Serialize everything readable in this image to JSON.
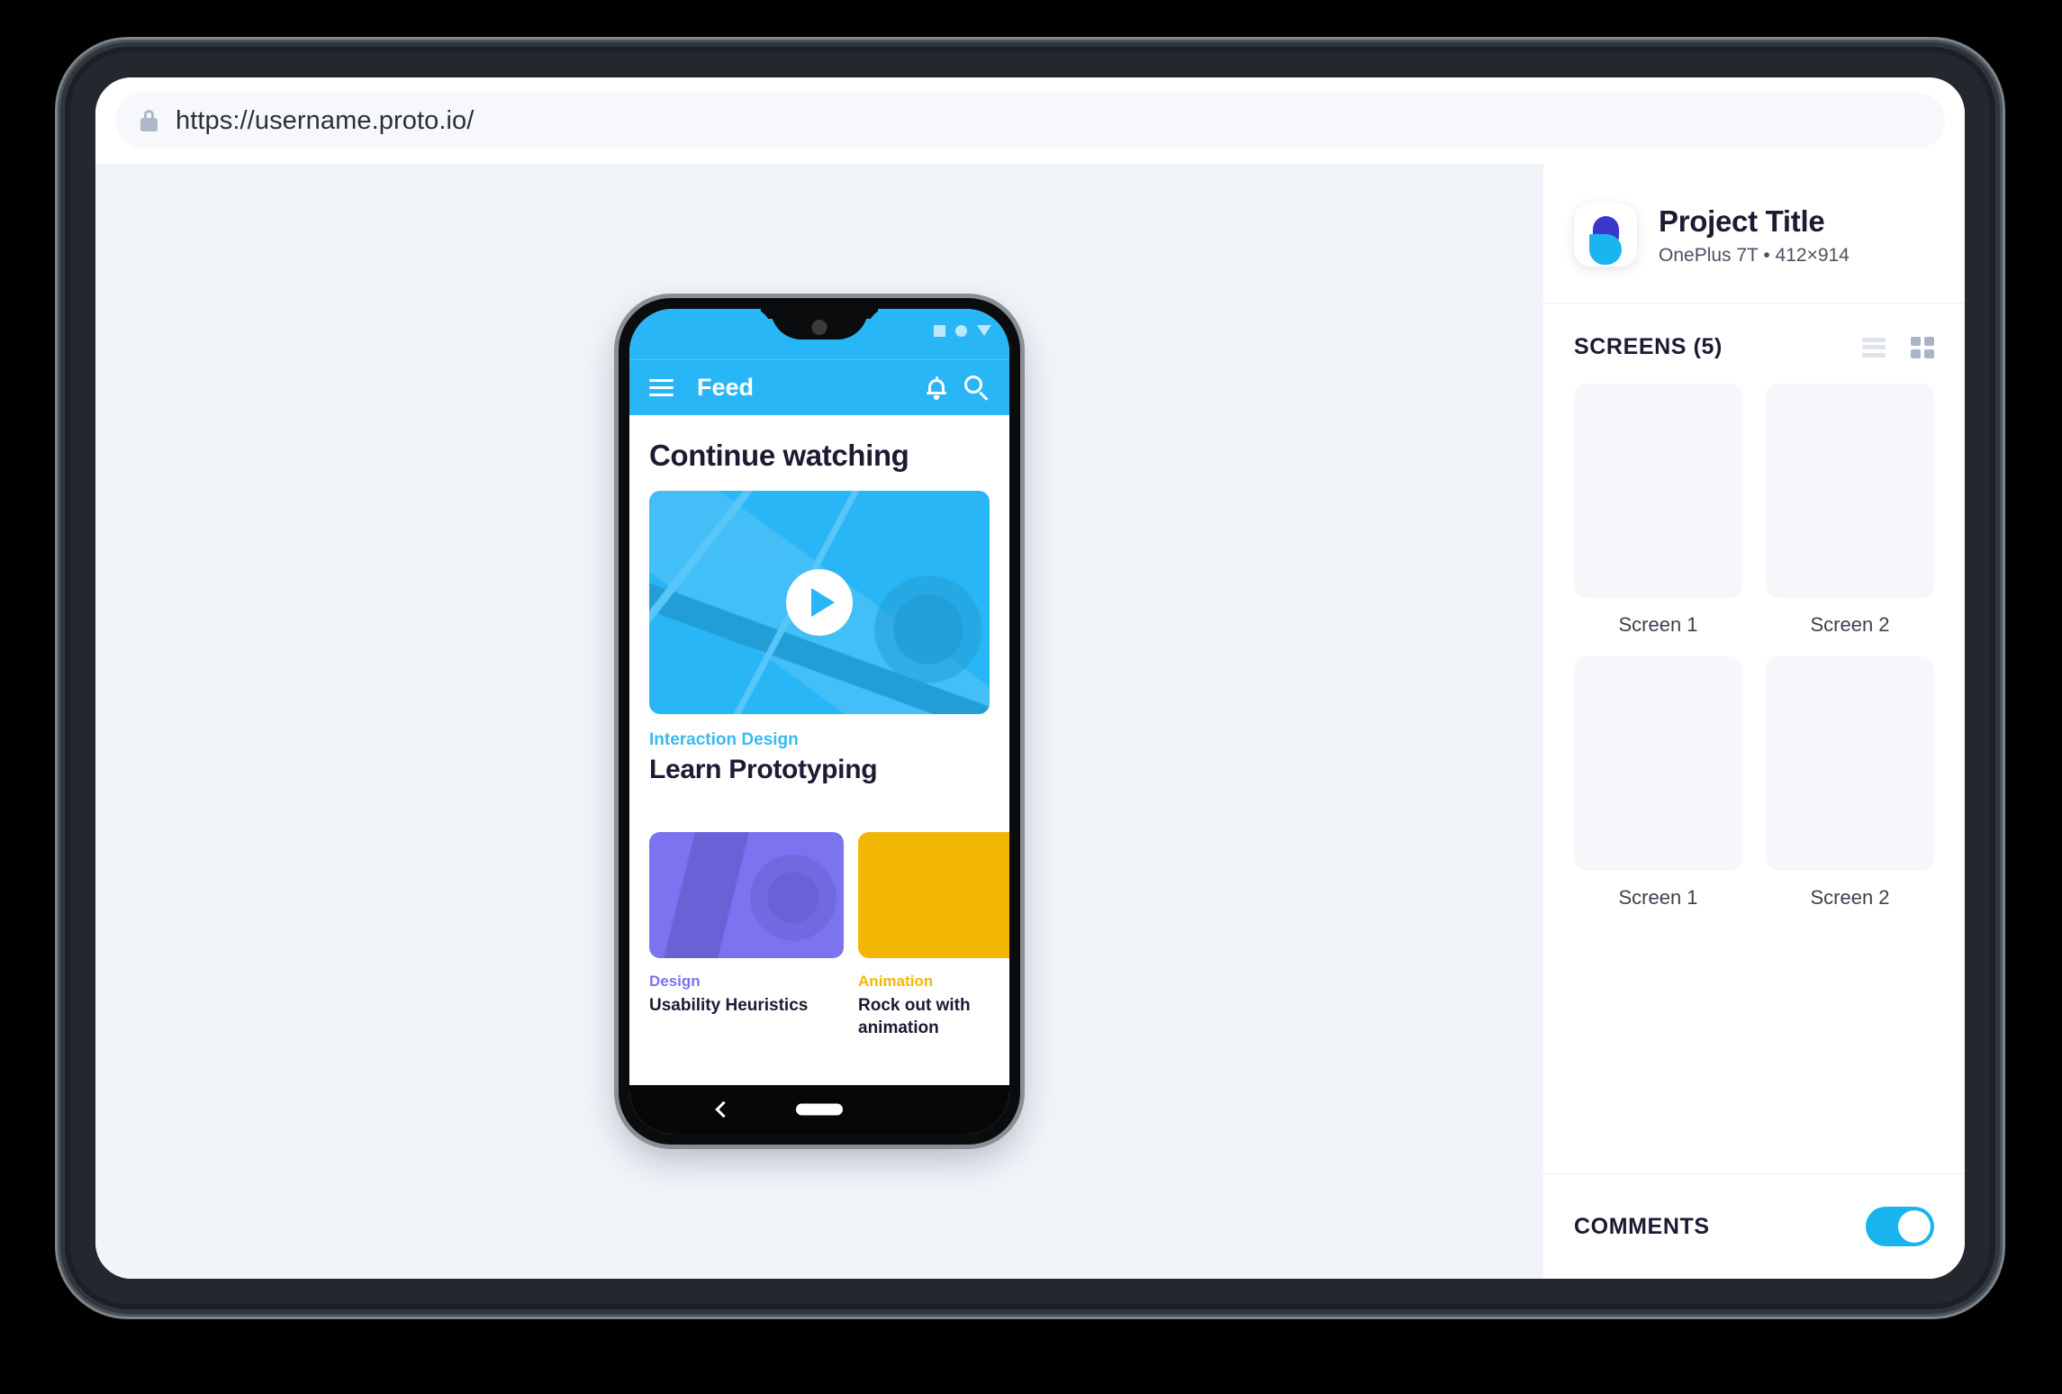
{
  "browser": {
    "url": "https://username.proto.io/",
    "lock_icon": "lock-icon"
  },
  "sidebar": {
    "project": {
      "title": "Project Title",
      "meta": "OnePlus 7T • 412×914",
      "logo_icon": "proto-logo-icon"
    },
    "screens": {
      "title": "SCREENS (5)",
      "view_list_icon": "list-view-icon",
      "view_grid_icon": "grid-view-icon",
      "items": [
        {
          "label": "Screen 1"
        },
        {
          "label": "Screen 2"
        },
        {
          "label": "Screen 1"
        },
        {
          "label": "Screen 2"
        }
      ]
    },
    "comments": {
      "label": "COMMENTS",
      "toggle_on": "on"
    }
  },
  "phone": {
    "status_icons": [
      "square-icon",
      "circle-icon",
      "triangle-down-icon"
    ],
    "app_bar": {
      "menu_icon": "hamburger-menu-icon",
      "title": "Feed",
      "bell_icon": "notification-bell-icon",
      "search_icon": "search-icon"
    },
    "content": {
      "heading": "Continue watching",
      "hero": {
        "play_icon": "play-icon",
        "kicker": "Interaction Design",
        "title": "Learn Prototyping"
      },
      "cards": [
        {
          "kicker": "Design",
          "title": "Usability Heuristics"
        },
        {
          "kicker": "Animation",
          "title": "Rock out with animation"
        }
      ]
    },
    "nav": {
      "back_icon": "back-chevron-icon",
      "home_icon": "home-pill-icon"
    }
  },
  "colors": {
    "accent_cyan": "#29B6F6",
    "toggle_on": "#17B4EF",
    "purple": "#7C73F0",
    "yellow": "#F2B705",
    "text_dark": "#1B1B33",
    "canvas": "#F1F4F9"
  }
}
